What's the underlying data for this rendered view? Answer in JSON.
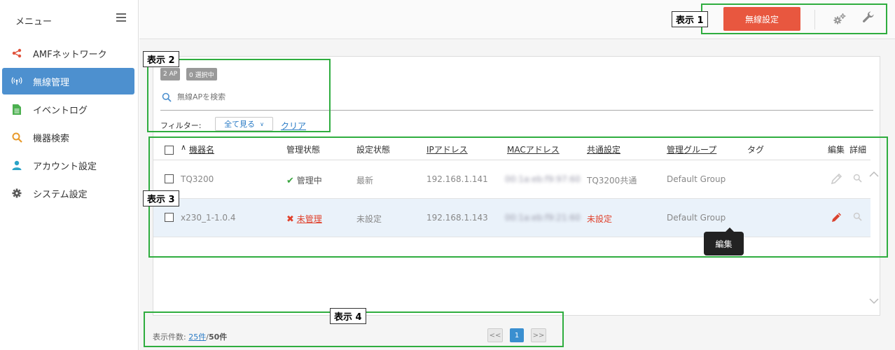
{
  "sidebar": {
    "title": "メニュー",
    "items": [
      {
        "label": "AMFネットワーク",
        "icon": "share-icon",
        "color": "#e0533c"
      },
      {
        "label": "無線管理",
        "icon": "wireless-icon",
        "color": "#ffffff"
      },
      {
        "label": "イベントログ",
        "icon": "document-icon",
        "color": "#4cb050"
      },
      {
        "label": "機器検索",
        "icon": "search-icon",
        "color": "#e89a2c"
      },
      {
        "label": "アカウント設定",
        "icon": "user-icon",
        "color": "#2aa3c7"
      },
      {
        "label": "システム設定",
        "icon": "gear-icon",
        "color": "#555555"
      }
    ]
  },
  "topbar": {
    "wireless_settings_label": "無線設定"
  },
  "list": {
    "ap_count": "2 AP",
    "selected_count": "0 選択中",
    "search_placeholder": "無線APを検索",
    "filter_label": "フィルター:",
    "filter_value": "全て見る",
    "clear_label": "クリア",
    "columns": {
      "name": "機器名",
      "manage_status": "管理状態",
      "config_status": "設定状態",
      "ip": "IPアドレス",
      "mac": "MACアドレス",
      "common": "共通設定",
      "group": "管理グループ",
      "tag": "タグ",
      "edit": "編集",
      "detail": "詳細"
    },
    "rows": [
      {
        "name": "TQ3200",
        "manage_status": "管理中",
        "config_status": "最新",
        "ip": "192.168.1.141",
        "mac": "00:1a:eb:f9:97:60",
        "common": "TQ3200共通",
        "group": "Default Group"
      },
      {
        "name": "x230_1-1.0.4",
        "manage_status": "未管理",
        "config_status": "未設定",
        "ip": "192.168.1.143",
        "mac": "00:1a:eb:f9:21:60",
        "common": "未設定",
        "group": "Default Group"
      }
    ],
    "tooltip": "編集"
  },
  "footer": {
    "count_label": "表示件数:",
    "per_page": "25件",
    "separator": "/",
    "total": "50件",
    "prev": "<<",
    "page": "1",
    "next": ">>"
  },
  "annotations": {
    "a1": "表示 1",
    "a2": "表示 2",
    "a3": "表示 3",
    "a4": "表示 4"
  },
  "colors": {
    "accent": "#4d90cf",
    "danger": "#e8573f",
    "annotation": "#2fad3f"
  }
}
